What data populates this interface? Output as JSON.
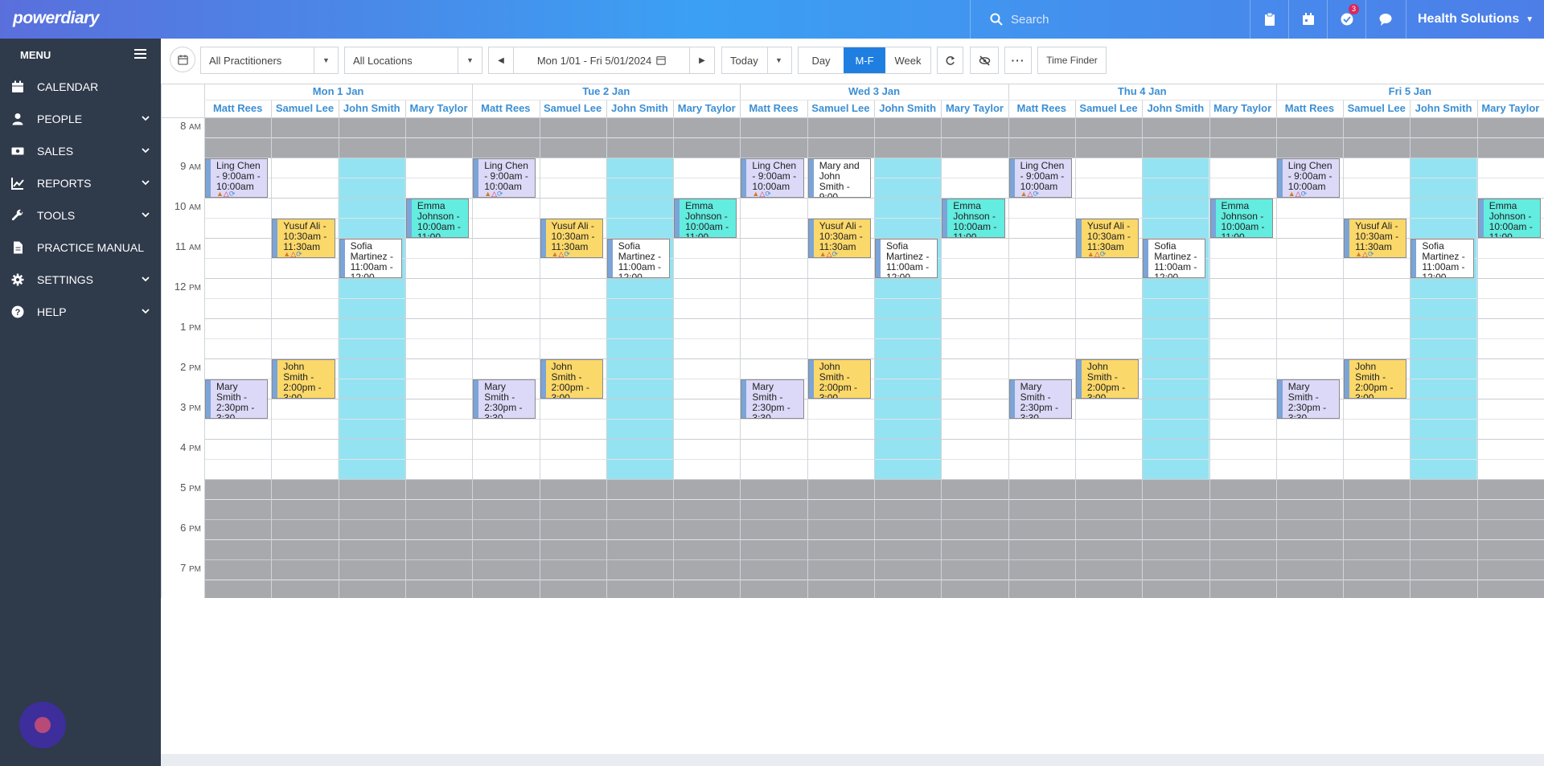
{
  "app": {
    "logo": "powerdiary",
    "search_placeholder": "Search",
    "notification_count": "3",
    "account_name": "Health Solutions"
  },
  "sidebar": {
    "menu_label": "MENU",
    "items": [
      {
        "label": "CALENDAR",
        "icon": "calendar-icon",
        "expandable": false
      },
      {
        "label": "PEOPLE",
        "icon": "person-icon",
        "expandable": true
      },
      {
        "label": "SALES",
        "icon": "money-icon",
        "expandable": true
      },
      {
        "label": "REPORTS",
        "icon": "chart-icon",
        "expandable": true
      },
      {
        "label": "TOOLS",
        "icon": "wrench-icon",
        "expandable": true
      },
      {
        "label": "PRACTICE MANUAL",
        "icon": "document-icon",
        "expandable": false
      },
      {
        "label": "SETTINGS",
        "icon": "gear-icon",
        "expandable": true
      },
      {
        "label": "HELP",
        "icon": "question-icon",
        "expandable": true
      }
    ]
  },
  "toolbar": {
    "practitioners_value": "All Practitioners",
    "locations_value": "All Locations",
    "date_range": "Mon 1/01 - Fri 5/01/2024",
    "today_label": "Today",
    "views": [
      "Day",
      "M-F",
      "Week"
    ],
    "active_view": "M-F",
    "time_finder_label": "Time Finder"
  },
  "calendar": {
    "days": [
      "Mon 1 Jan",
      "Tue 2 Jan",
      "Wed 3 Jan",
      "Thu 4 Jan",
      "Fri 5 Jan"
    ],
    "practitioners": [
      "Matt Rees",
      "Samuel Lee",
      "John Smith",
      "Mary Taylor"
    ],
    "hours": [
      {
        "h": "8",
        "ampm": "AM"
      },
      {
        "h": "9",
        "ampm": "AM"
      },
      {
        "h": "10",
        "ampm": "AM"
      },
      {
        "h": "11",
        "ampm": "AM"
      },
      {
        "h": "12",
        "ampm": "PM"
      },
      {
        "h": "1",
        "ampm": "PM"
      },
      {
        "h": "2",
        "ampm": "PM"
      },
      {
        "h": "3",
        "ampm": "PM"
      },
      {
        "h": "4",
        "ampm": "PM"
      },
      {
        "h": "5",
        "ampm": "PM"
      },
      {
        "h": "6",
        "ampm": "PM"
      },
      {
        "h": "7",
        "ampm": "PM"
      }
    ],
    "colors": {
      "closed": "#a7a9ad",
      "off_duty": "#94e3f2",
      "lavender": "#dcd8f7",
      "yellow": "#fbd86a",
      "aqua": "#63ece0",
      "white": "#ffffff",
      "header_text": "#3c8fd4"
    },
    "appointments": [
      {
        "day": 0,
        "prac": 0,
        "start": 9.0,
        "end": 10.0,
        "lines": [
          "Ling Chen",
          "- 9:00am -",
          "10:00am"
        ],
        "color": "lavender",
        "icons": true
      },
      {
        "day": 0,
        "prac": 1,
        "start": 10.5,
        "end": 11.5,
        "lines": [
          "Yusuf Ali -",
          "10:30am -",
          "11:30am"
        ],
        "color": "yellow",
        "icons": true
      },
      {
        "day": 0,
        "prac": 2,
        "start": 11.0,
        "end": 12.0,
        "lines": [
          "Sofia",
          "Martinez -",
          "11:00am -",
          "12:00"
        ],
        "color": "white",
        "icons": false
      },
      {
        "day": 0,
        "prac": 3,
        "start": 10.0,
        "end": 11.0,
        "lines": [
          "Emma",
          "Johnson -",
          "10:00am -",
          "11:00"
        ],
        "color": "aqua",
        "icons": false
      },
      {
        "day": 0,
        "prac": 1,
        "start": 14.0,
        "end": 15.0,
        "lines": [
          "John",
          "Smith -",
          "2:00pm -",
          "3:00"
        ],
        "color": "yellow",
        "icons": false
      },
      {
        "day": 0,
        "prac": 0,
        "start": 14.5,
        "end": 15.5,
        "lines": [
          "Mary",
          "Smith -",
          "2:30pm -",
          "3:30"
        ],
        "color": "lavender",
        "icons": false
      },
      {
        "day": 1,
        "prac": 0,
        "start": 9.0,
        "end": 10.0,
        "lines": [
          "Ling Chen",
          "- 9:00am -",
          "10:00am"
        ],
        "color": "lavender",
        "icons": true
      },
      {
        "day": 1,
        "prac": 1,
        "start": 10.5,
        "end": 11.5,
        "lines": [
          "Yusuf Ali -",
          "10:30am -",
          "11:30am"
        ],
        "color": "yellow",
        "icons": true
      },
      {
        "day": 1,
        "prac": 2,
        "start": 11.0,
        "end": 12.0,
        "lines": [
          "Sofia",
          "Martinez -",
          "11:00am -",
          "12:00"
        ],
        "color": "white",
        "icons": false
      },
      {
        "day": 1,
        "prac": 3,
        "start": 10.0,
        "end": 11.0,
        "lines": [
          "Emma",
          "Johnson -",
          "10:00am -",
          "11:00"
        ],
        "color": "aqua",
        "icons": false
      },
      {
        "day": 1,
        "prac": 1,
        "start": 14.0,
        "end": 15.0,
        "lines": [
          "John",
          "Smith -",
          "2:00pm -",
          "3:00"
        ],
        "color": "yellow",
        "icons": false
      },
      {
        "day": 1,
        "prac": 0,
        "start": 14.5,
        "end": 15.5,
        "lines": [
          "Mary",
          "Smith -",
          "2:30pm -",
          "3:30"
        ],
        "color": "lavender",
        "icons": false
      },
      {
        "day": 2,
        "prac": 0,
        "start": 9.0,
        "end": 10.0,
        "lines": [
          "Ling Chen",
          "- 9:00am -",
          "10:00am"
        ],
        "color": "lavender",
        "icons": true
      },
      {
        "day": 2,
        "prac": 1,
        "start": 9.0,
        "end": 10.0,
        "lines": [
          "Mary and",
          "John",
          "Smith -",
          "9:00"
        ],
        "color": "white",
        "icons": false
      },
      {
        "day": 2,
        "prac": 1,
        "start": 10.5,
        "end": 11.5,
        "lines": [
          "Yusuf Ali -",
          "10:30am -",
          "11:30am"
        ],
        "color": "yellow",
        "icons": true
      },
      {
        "day": 2,
        "prac": 2,
        "start": 11.0,
        "end": 12.0,
        "lines": [
          "Sofia",
          "Martinez -",
          "11:00am -",
          "12:00"
        ],
        "color": "white",
        "icons": false
      },
      {
        "day": 2,
        "prac": 3,
        "start": 10.0,
        "end": 11.0,
        "lines": [
          "Emma",
          "Johnson -",
          "10:00am -",
          "11:00"
        ],
        "color": "aqua",
        "icons": false
      },
      {
        "day": 2,
        "prac": 1,
        "start": 14.0,
        "end": 15.0,
        "lines": [
          "John",
          "Smith -",
          "2:00pm -",
          "3:00"
        ],
        "color": "yellow",
        "icons": false
      },
      {
        "day": 2,
        "prac": 0,
        "start": 14.5,
        "end": 15.5,
        "lines": [
          "Mary",
          "Smith -",
          "2:30pm -",
          "3:30"
        ],
        "color": "lavender",
        "icons": false
      },
      {
        "day": 3,
        "prac": 0,
        "start": 9.0,
        "end": 10.0,
        "lines": [
          "Ling Chen",
          "- 9:00am -",
          "10:00am"
        ],
        "color": "lavender",
        "icons": true
      },
      {
        "day": 3,
        "prac": 1,
        "start": 10.5,
        "end": 11.5,
        "lines": [
          "Yusuf Ali -",
          "10:30am -",
          "11:30am"
        ],
        "color": "yellow",
        "icons": true
      },
      {
        "day": 3,
        "prac": 2,
        "start": 11.0,
        "end": 12.0,
        "lines": [
          "Sofia",
          "Martinez -",
          "11:00am -",
          "12:00"
        ],
        "color": "white",
        "icons": false
      },
      {
        "day": 3,
        "prac": 3,
        "start": 10.0,
        "end": 11.0,
        "lines": [
          "Emma",
          "Johnson -",
          "10:00am -",
          "11:00"
        ],
        "color": "aqua",
        "icons": false
      },
      {
        "day": 3,
        "prac": 1,
        "start": 14.0,
        "end": 15.0,
        "lines": [
          "John",
          "Smith -",
          "2:00pm -",
          "3:00"
        ],
        "color": "yellow",
        "icons": false
      },
      {
        "day": 3,
        "prac": 0,
        "start": 14.5,
        "end": 15.5,
        "lines": [
          "Mary",
          "Smith -",
          "2:30pm -",
          "3:30"
        ],
        "color": "lavender",
        "icons": false
      },
      {
        "day": 4,
        "prac": 0,
        "start": 9.0,
        "end": 10.0,
        "lines": [
          "Ling Chen",
          "- 9:00am -",
          "10:00am"
        ],
        "color": "lavender",
        "icons": true
      },
      {
        "day": 4,
        "prac": 1,
        "start": 10.5,
        "end": 11.5,
        "lines": [
          "Yusuf Ali -",
          "10:30am -",
          "11:30am"
        ],
        "color": "yellow",
        "icons": true
      },
      {
        "day": 4,
        "prac": 2,
        "start": 11.0,
        "end": 12.0,
        "lines": [
          "Sofia",
          "Martinez -",
          "11:00am -",
          "12:00"
        ],
        "color": "white",
        "icons": false
      },
      {
        "day": 4,
        "prac": 3,
        "start": 10.0,
        "end": 11.0,
        "lines": [
          "Emma",
          "Johnson -",
          "10:00am -",
          "11:00"
        ],
        "color": "aqua",
        "icons": false
      },
      {
        "day": 4,
        "prac": 1,
        "start": 14.0,
        "end": 15.0,
        "lines": [
          "John",
          "Smith -",
          "2:00pm -",
          "3:00"
        ],
        "color": "yellow",
        "icons": false
      },
      {
        "day": 4,
        "prac": 0,
        "start": 14.5,
        "end": 15.5,
        "lines": [
          "Mary",
          "Smith -",
          "2:30pm -",
          "3:30"
        ],
        "color": "lavender",
        "icons": false
      }
    ]
  }
}
